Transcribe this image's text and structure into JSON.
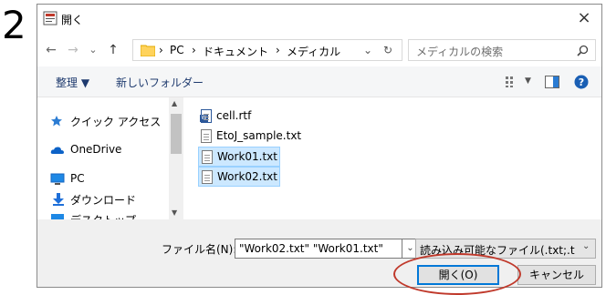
{
  "step_number": "2",
  "window": {
    "title": "開く",
    "close_symbol": "×"
  },
  "nav_buttons": {
    "back": "←",
    "forward": "→",
    "recent": "⌄",
    "up": "↑"
  },
  "address": {
    "crumbs": [
      "PC",
      "ドキュメント",
      "メディカル"
    ],
    "separator": "›",
    "dropdown": "⌄",
    "refresh": "↻"
  },
  "search": {
    "placeholder": "メディカルの検索",
    "icon": "search-icon"
  },
  "toolbar": {
    "organize": "整理 ▼",
    "new_folder": "新しいフォルダー",
    "view_dropdown": "▼"
  },
  "nav_pane": {
    "items": [
      "クイック アクセス",
      "OneDrive",
      "PC",
      "ダウンロード",
      "デスクトップ"
    ]
  },
  "files": [
    {
      "name": "cell.rtf",
      "selected": false,
      "icon": "rtf-file-icon"
    },
    {
      "name": "EtoJ_sample.txt",
      "selected": false,
      "icon": "text-file-icon"
    },
    {
      "name": "Work01.txt",
      "selected": true,
      "icon": "text-file-icon"
    },
    {
      "name": "Work02.txt",
      "selected": true,
      "icon": "text-file-icon"
    }
  ],
  "bottom": {
    "filename_label": "ファイル名(N):",
    "filename_value": "\"Work02.txt\" \"Work01.txt\"",
    "filter_value": "読み込み可能なファイル(.txt;.txt;",
    "open_label": "開く(O)",
    "cancel_label": "キャンセル"
  },
  "colors": {
    "selection": "#cce8ff",
    "accent": "#0078d7",
    "annotation": "#c0392b"
  }
}
